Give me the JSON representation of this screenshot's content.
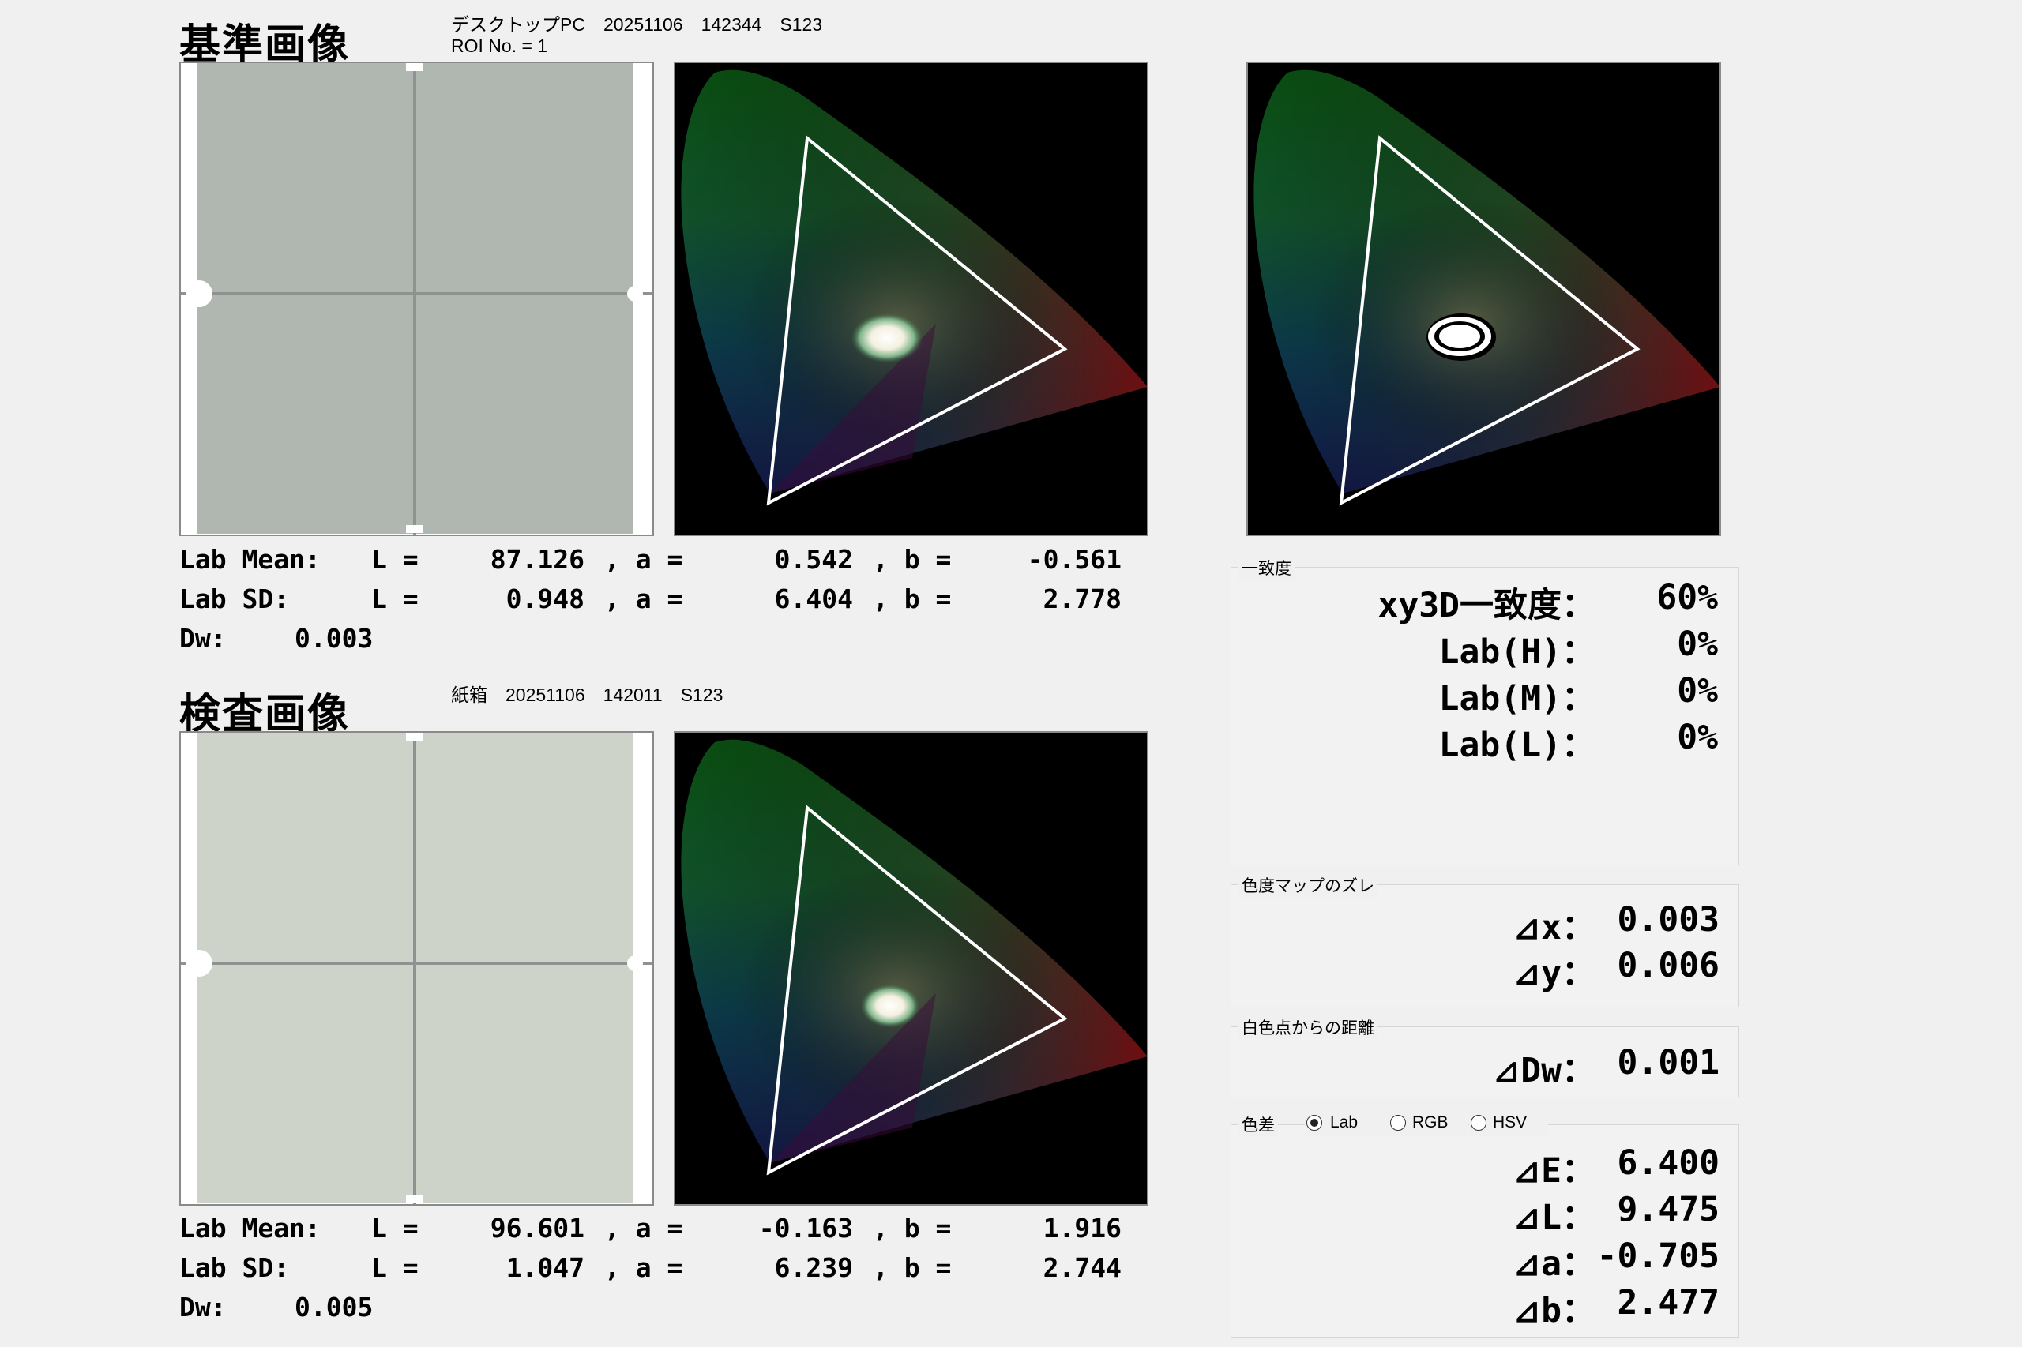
{
  "reference": {
    "title": "基準画像",
    "meta_line1": "デスクトップPC　20251106　142344　S123",
    "meta_line2": "ROI No. = 1",
    "lab_mean": {
      "label": "Lab Mean:",
      "L": "87.126",
      "a": "0.542",
      "b": "-0.561"
    },
    "lab_sd": {
      "label": "Lab SD:",
      "L": "0.948",
      "a": "6.404",
      "b": "2.778"
    },
    "dw": {
      "label": "Dw:",
      "value": "0.003"
    },
    "sample_color": "#b0b6b0"
  },
  "inspection": {
    "title": "検査画像",
    "meta_line1": "紙箱　20251106　142011　S123",
    "lab_mean": {
      "label": "Lab Mean:",
      "L": "96.601",
      "a": "-0.163",
      "b": "1.916"
    },
    "lab_sd": {
      "label": "Lab SD:",
      "L": "1.047",
      "a": "6.239",
      "b": "2.744"
    },
    "dw": {
      "label": "Dw:",
      "value": "0.005"
    },
    "sample_color": "#cdd3c8"
  },
  "stat_tokens": {
    "L": "L =",
    "a": ", a =",
    "b": ", b ="
  },
  "match": {
    "group_label": "一致度",
    "rows": [
      {
        "label": "xy3D一致度：",
        "value": "60%"
      },
      {
        "label": "Lab(H)：",
        "value": "0%"
      },
      {
        "label": "Lab(M)：",
        "value": "0%"
      },
      {
        "label": "Lab(L)：",
        "value": "0%"
      }
    ]
  },
  "shift": {
    "group_label": "色度マップのズレ",
    "rows": [
      {
        "label": "⊿x：",
        "value": "0.003"
      },
      {
        "label": "⊿y：",
        "value": "0.006"
      }
    ]
  },
  "white_dist": {
    "group_label": "白色点からの距離",
    "rows": [
      {
        "label": "⊿Dw：",
        "value": "0.001"
      }
    ]
  },
  "color_diff": {
    "group_label": "色差",
    "radio_options": [
      "Lab",
      "RGB",
      "HSV"
    ],
    "selected": "Lab",
    "rows": [
      {
        "label": "⊿E：",
        "value": "6.400"
      },
      {
        "label": "⊿L：",
        "value": "9.475"
      },
      {
        "label": "⊿a：",
        "value": "-0.705"
      },
      {
        "label": "⊿b：",
        "value": "2.477"
      }
    ]
  },
  "colors": {
    "panel_border": "#8a8a8a",
    "chart_bg": "#000000",
    "triangle": "#ffffff"
  }
}
